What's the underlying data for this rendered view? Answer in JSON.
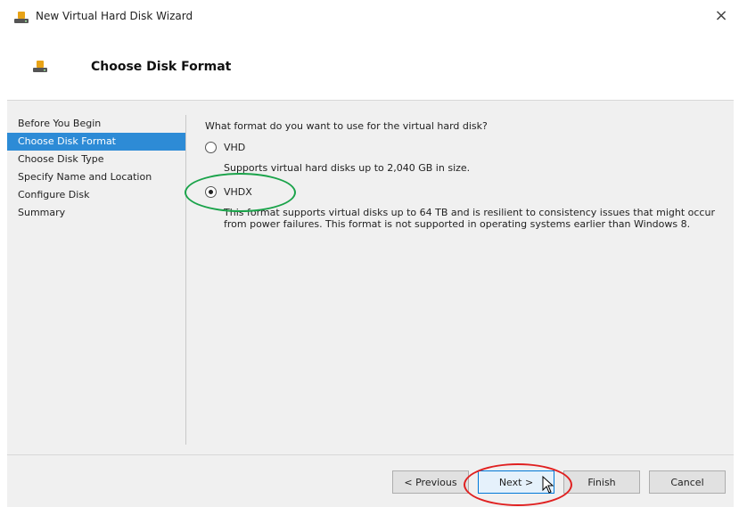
{
  "window": {
    "title": "New Virtual Hard Disk Wizard",
    "close_symbol": "×"
  },
  "header": {
    "title": "Choose Disk Format"
  },
  "steps": [
    {
      "label": "Before You Begin",
      "active": false
    },
    {
      "label": "Choose Disk Format",
      "active": true
    },
    {
      "label": "Choose Disk Type",
      "active": false
    },
    {
      "label": "Specify Name and Location",
      "active": false
    },
    {
      "label": "Configure Disk",
      "active": false
    },
    {
      "label": "Summary",
      "active": false
    }
  ],
  "main": {
    "question": "What format do you want to use for the virtual hard disk?",
    "options": [
      {
        "label": "VHD",
        "checked": false,
        "description": "Supports virtual hard disks up to 2,040 GB in size."
      },
      {
        "label": "VHDX",
        "checked": true,
        "description_line1": "This format supports virtual disks up to 64 TB and is resilient to consistency issues that might occur",
        "description_line2": "from power failures. This format is not supported in operating systems earlier than Windows 8."
      }
    ]
  },
  "buttons": {
    "previous": "< Previous",
    "next": "Next >",
    "finish": "Finish",
    "cancel": "Cancel"
  },
  "colors": {
    "active_step": "#2d8bd6",
    "annotation_green": "#1aa34a",
    "annotation_red": "#e02020"
  },
  "icons": {
    "app": "disk-drive-icon",
    "cursor": "mouse-pointer-icon"
  }
}
